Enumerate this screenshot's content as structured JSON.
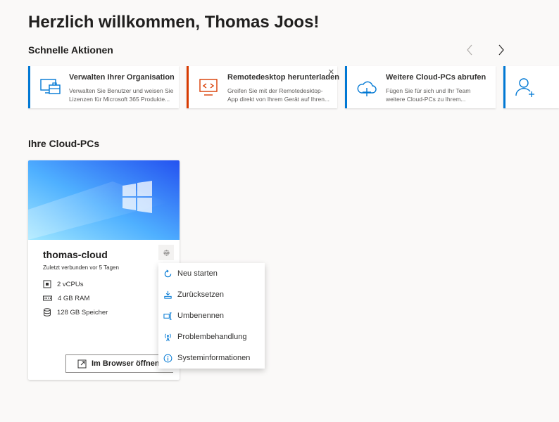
{
  "header": {
    "welcome": "Herzlich willkommen, Thomas Joos!"
  },
  "quick_actions": {
    "title": "Schnelle Aktionen",
    "cards": [
      {
        "title": "Verwalten Ihrer Organisation",
        "description": "Verwalten Sie Benutzer und weisen Sie Lizenzen für Microsoft 365 Produkte...",
        "icon": "organization-icon"
      },
      {
        "title": "Remotedesktop herunterladen",
        "description": "Greifen Sie mit der Remotedesktop-App direkt von Ihrem Gerät auf Ihren...",
        "icon": "remote-desktop-icon",
        "dismiss": "✕"
      },
      {
        "title": "Weitere Cloud-PCs abrufen",
        "description": "Fügen Sie für sich und Ihr Team weitere Cloud-PCs zu Ihrem...",
        "icon": "cloud-add-icon"
      },
      {
        "icon": "person-add-icon"
      }
    ],
    "prev_icon": "chevron-left-icon",
    "next_icon": "chevron-right-icon"
  },
  "cloud_pcs": {
    "title": "Ihre Cloud-PCs",
    "pc": {
      "name": "thomas-cloud",
      "last_connected": "Zuletzt verbunden vor 5 Tagen",
      "specs": [
        {
          "icon": "cpu-icon",
          "label": "2 vCPUs"
        },
        {
          "icon": "ram-icon",
          "label": "4 GB RAM"
        },
        {
          "icon": "storage-icon",
          "label": "128 GB Speicher"
        }
      ],
      "open_button": "Im Browser öffnen"
    }
  },
  "context_menu": {
    "items": [
      {
        "label": "Neu starten",
        "icon": "restart-icon"
      },
      {
        "label": "Zurücksetzen",
        "icon": "reset-icon"
      },
      {
        "label": "Umbenennen",
        "icon": "rename-icon"
      },
      {
        "label": "Problembehandlung",
        "icon": "troubleshoot-icon"
      },
      {
        "label": "Systeminformationen",
        "icon": "info-icon"
      }
    ]
  },
  "colors": {
    "accent": "#0078d4",
    "orange_accent": "#d83b01",
    "background": "#faf9f8"
  }
}
